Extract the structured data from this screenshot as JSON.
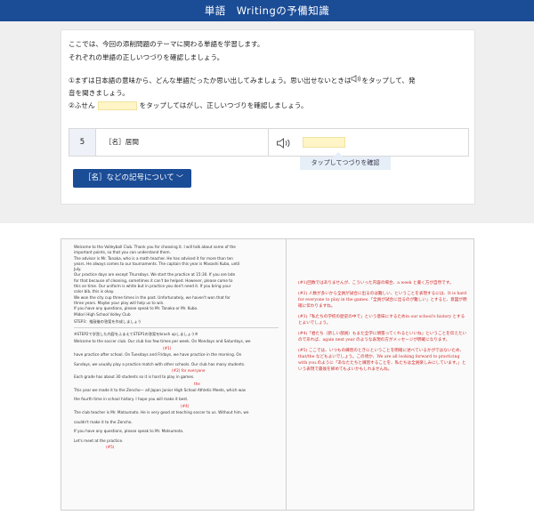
{
  "header": {
    "title": "単語　Writingの予備知識"
  },
  "intro": {
    "line1": "ここでは、今回の添削問題のテーマに関わる単語を学習します。",
    "line2": "それぞれの単語の正しいつづりを確認しましょう。"
  },
  "steps": {
    "step1_a": "①まずは日本語の意味から、どんな単語だったか思い出してみましょう。思い出せないときは",
    "step1_b": "をタップして、発",
    "step1_c": "音を聞きましょう。",
    "step2_a": "②ふせん",
    "step2_b": "をタップしてはがし、正しいつづりを確認しましょう。"
  },
  "word_row": {
    "number": "5",
    "hint": "［名］居間",
    "speaker_icon": "speaker-icon"
  },
  "tooltip": "タップしてつづりを確認",
  "symbol_button": {
    "label": "［名］などの記号について",
    "chevron": "﹀"
  },
  "colors": {
    "header": "#1b4c96",
    "sticky": "#fff5c6",
    "tooltip_bg": "#e6eef8",
    "annotation": "#d12828"
  },
  "document": {
    "left": [
      "Welcome to the Volleyball Club. Thank you for choosing it. I will talk about some of the",
      "important points, so that you can understand them.",
      "The advisor is Mr. Tanaka, who is a math teacher. He has advised it for more than ten",
      "years. He always comes to our tournaments. The captain this year is Masashi Kubo, until",
      "July.",
      "Our practice days are except Thursdays. We start the practice at 15:30. If you are late",
      "for that because of cleaning, sometimes it can't be helped. However, please come to",
      "this on time. Our uniform is white but in practice you don't need it. If you bring your",
      "color bib, this is okay.",
      "We won the city cup three times in the past. Unfortunately, we haven't won that for",
      "three years. Maybe your play will help us to win.",
      "If you have any questions, please speak to Mr. Tanaka or Mr. Kubo.",
      "Midori High School Volley Club"
    ],
    "step_label": "STEP3：推敲後の答案を作成しましょう",
    "step_note": "※STEP2で学習した内容をふまえてSTEP1の答案をbrush upしましょう※",
    "inner": [
      "Welcome to the soccer club. Our club has few times per week. On Mondays and Saturdays, we",
      "have practice after school. On Tuesdays and Fridays, we have practice in the morning. On",
      "Sundays, we usually play a practice match with other schools. Our club has many students.",
      "Each grade has about 30 students so it is hard to play in games.",
      "This year we made it to the Zencho— all Japan Junior High School Athletic Meets, which was",
      "the fourth time in school history. I hope you will make it best.",
      "The club teacher is Mr. Matsumoto. He is very good at teaching soccer to us. Without him, we",
      "couldn't make it to the Zencho.",
      "If you have any questions, please speak to Mr. Matsumoto.",
      "Let's meet at the practice."
    ],
    "inner_marks": {
      "m1": "(#1)",
      "m2": "(#2) for everyone",
      "m3": "the",
      "m4": "(#4)",
      "m5": "(#5)"
    },
    "right": [
      "(#1)回数ではありませんが、こういった内容の場合、a week と書く方が自然です。",
      "(#2) 人数が多いから全員が試合に出るのは難しい、ということを表現するには、It is hard for everyone to play in the games.「全員が試合に出るのが難しい」とすると、意図が明確に伝わりますね。",
      "(#3)「私たちの学校の歴史の中で」という意味にするためin our school's history とするとよいでしょう。",
      "(#4)「君たち（新しい部員）もまた全学に頑張ってくれるといいね」ということを伝えたいのであれば、again next year のような表現の方がメッセージが明確になります。",
      "(#5) ここでは、いつもの練習のときにということを明確に述べているかがではないため、that/the などもよいでしょう。この頃か、We are all looking forward to practicing with you.のように「あなたたちと練習することを、私たちは全員楽しみにしています。」という表現で最後を締めてもよいかもしれませんね。"
    ]
  }
}
